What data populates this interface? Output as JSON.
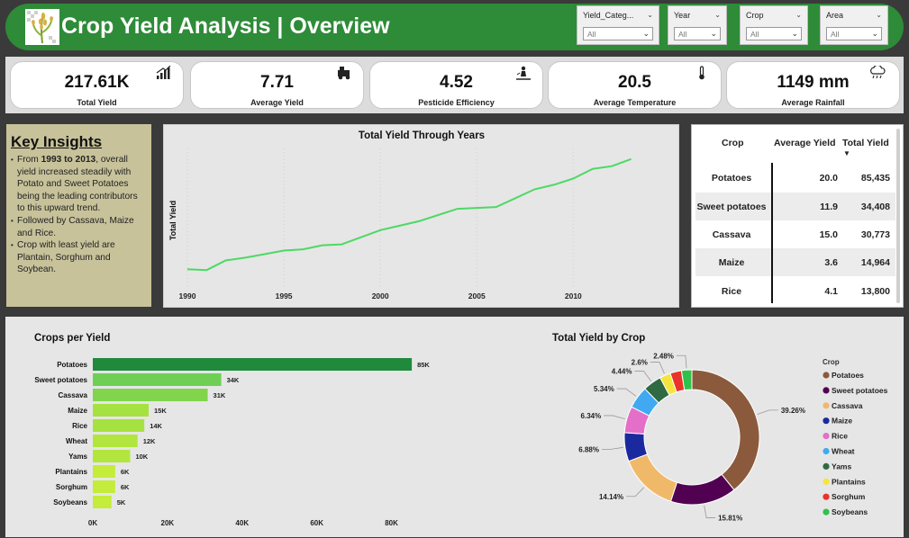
{
  "header": {
    "title": "Crop Yield Analysis | Overview"
  },
  "slicers": [
    {
      "label": "Yield_Categ...",
      "value": "All"
    },
    {
      "label": "Year",
      "value": "All"
    },
    {
      "label": "Crop",
      "value": "All"
    },
    {
      "label": "Area",
      "value": "All"
    }
  ],
  "kpis": [
    {
      "value": "217.61K",
      "label": "Total Yield",
      "icon": "bar-chart-icon"
    },
    {
      "value": "7.71",
      "label": "Average Yield",
      "icon": "harvester-icon"
    },
    {
      "value": "4.52",
      "label": "Pesticide Efficiency",
      "icon": "sprayer-icon"
    },
    {
      "value": "20.5",
      "label": "Average Temperature",
      "icon": "thermometer-icon"
    },
    {
      "value": "1149 mm",
      "label": "Average Rainfall",
      "icon": "rain-cloud-icon"
    }
  ],
  "insights": {
    "heading": "Key Insights",
    "items": [
      {
        "pre": "From ",
        "bold": "1993 to 2013",
        "post": ", overall yield increased steadily with Potato and Sweet Potatoes being the leading contributors to this upward trend."
      },
      {
        "pre": "Followed by Cassava, Maize and Rice.",
        "bold": "",
        "post": ""
      },
      {
        "pre": "Crop with least yield are Plantain, Sorghum and Soybean.",
        "bold": "",
        "post": ""
      }
    ]
  },
  "table": {
    "headers": [
      "Crop",
      "Average Yield",
      "Total Yield"
    ],
    "rows": [
      [
        "Potatoes",
        "20.0",
        "85,435"
      ],
      [
        "Sweet potatoes",
        "11.9",
        "34,408"
      ],
      [
        "Cassava",
        "15.0",
        "30,773"
      ],
      [
        "Maize",
        "3.6",
        "14,964"
      ],
      [
        "Rice",
        "4.1",
        "13,800"
      ]
    ]
  },
  "chart_data": [
    {
      "type": "line",
      "title": "Total Yield Through Years",
      "xlabel": "",
      "ylabel": "Total Yield",
      "x": [
        1990,
        1991,
        1992,
        1993,
        1994,
        1995,
        1996,
        1997,
        1998,
        1999,
        2000,
        2001,
        2002,
        2003,
        2004,
        2005,
        2006,
        2007,
        2008,
        2009,
        2010,
        2011,
        2012,
        2013
      ],
      "y": [
        7500,
        7450,
        8000,
        8150,
        8350,
        8550,
        8620,
        8850,
        8900,
        9300,
        9700,
        9950,
        10200,
        10550,
        10900,
        10950,
        11000,
        11500,
        12000,
        12250,
        12600,
        13150,
        13300,
        13700
      ],
      "xticks": [
        1990,
        1995,
        2000,
        2005,
        2010
      ],
      "ylim": [
        6500,
        14500
      ],
      "color": "#4cd964",
      "grid": true
    },
    {
      "type": "bar",
      "orientation": "horizontal",
      "title": "Crops per Yield",
      "categories": [
        "Potatoes",
        "Sweet potatoes",
        "Cassava",
        "Maize",
        "Rice",
        "Wheat",
        "Yams",
        "Plantains",
        "Sorghum",
        "Soybeans"
      ],
      "values": [
        85435,
        34408,
        30773,
        14964,
        13800,
        12000,
        10000,
        6000,
        6000,
        5000
      ],
      "labels": [
        "85K",
        "34K",
        "31K",
        "15K",
        "14K",
        "12K",
        "10K",
        "6K",
        "6K",
        "5K"
      ],
      "xticks": [
        "0K",
        "20K",
        "40K",
        "60K",
        "80K"
      ],
      "xlim": [
        0,
        90000
      ],
      "colors": [
        "#1f8a3b",
        "#6fcf55",
        "#82d44c",
        "#a6e23f",
        "#a6e23f",
        "#b2e63e",
        "#b2e63e",
        "#c4ec3a",
        "#c4ec3a",
        "#c4ec3a"
      ]
    },
    {
      "type": "pie",
      "variant": "donut",
      "title": "Total Yield by Crop",
      "legend_title": "Crop",
      "legend_position": "right",
      "slices": [
        {
          "name": "Potatoes",
          "value": 39.26,
          "label": "39.26%",
          "color": "#8b5a3c"
        },
        {
          "name": "Sweet potatoes",
          "value": 15.81,
          "label": "15.81%",
          "color": "#520052"
        },
        {
          "name": "Cassava",
          "value": 14.14,
          "label": "14.14%",
          "color": "#f0b96a"
        },
        {
          "name": "Maize",
          "value": 6.88,
          "label": "6.88%",
          "color": "#1a2a9e"
        },
        {
          "name": "Rice",
          "value": 6.34,
          "label": "6.34%",
          "color": "#e36fc9"
        },
        {
          "name": "Wheat",
          "value": 5.34,
          "label": "5.34%",
          "color": "#41a9f2"
        },
        {
          "name": "Yams",
          "value": 4.44,
          "label": "4.44%",
          "color": "#2f6a42"
        },
        {
          "name": "Plantains",
          "value": 2.6,
          "label": "2.6%",
          "color": "#f4e53c"
        },
        {
          "name": "Sorghum",
          "value": 2.71,
          "label": "",
          "color": "#e8342a"
        },
        {
          "name": "Soybeans",
          "value": 2.48,
          "label": "2.48%",
          "color": "#2fc24a"
        }
      ]
    }
  ]
}
